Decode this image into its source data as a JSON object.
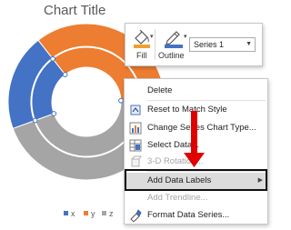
{
  "chart": {
    "title": "Chart Title",
    "legend": [
      {
        "label": "x",
        "color": "#4472c4"
      },
      {
        "label": "y",
        "color": "#ed7d31"
      },
      {
        "label": "z",
        "color": "#a5a5a5"
      }
    ]
  },
  "chart_data": {
    "type": "doughnut",
    "title": "Chart Title",
    "categories": [
      "x",
      "y",
      "z"
    ],
    "colors": [
      "#4472c4",
      "#ed7d31",
      "#a5a5a5"
    ],
    "series": [
      {
        "values": [
          20,
          35,
          45
        ]
      },
      {
        "values": [
          20,
          35,
          45
        ]
      }
    ],
    "legend_position": "bottom"
  },
  "mini_toolbar": {
    "fill_label": "Fill",
    "outline_label": "Outline",
    "series_select_value": "Series 1",
    "fill_color": "#f0a030",
    "outline_color": "#4472c4"
  },
  "context_menu": {
    "items": [
      {
        "label": "Delete",
        "icon": "blank",
        "disabled": false
      },
      {
        "label": "Reset to Match Style",
        "icon": "reset-icon",
        "disabled": false
      },
      {
        "label": "Change Series Chart Type...",
        "icon": "chart-type-icon",
        "disabled": false
      },
      {
        "label": "Select Data...",
        "icon": "select-data-icon",
        "disabled": false
      },
      {
        "label": "3-D Rotation...",
        "icon": "3d-rotation-icon",
        "disabled": true
      },
      {
        "label": "Add Data Labels",
        "icon": "blank",
        "disabled": false,
        "submenu": true
      },
      {
        "label": "Add Trendline...",
        "icon": "blank",
        "disabled": true
      },
      {
        "label": "Format Data Series...",
        "icon": "format-series-icon",
        "disabled": false
      }
    ]
  },
  "annotation": {
    "arrow_color": "#e00000",
    "box_color": "#111111"
  }
}
